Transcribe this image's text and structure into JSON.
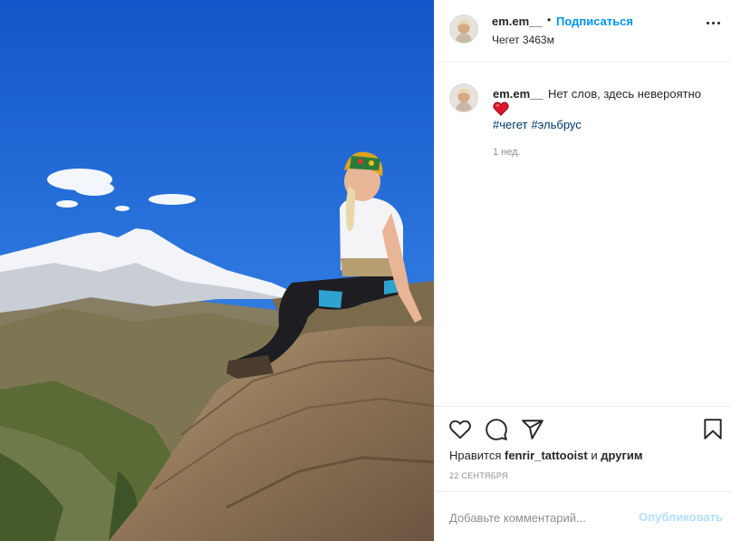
{
  "header": {
    "username": "em.em__",
    "dot": "•",
    "follow_label": "Подписаться",
    "location": "Чегет 3463м"
  },
  "caption": {
    "username": "em.em__",
    "text": "Нет слов, здесь невероятно",
    "emoji": "red-heart",
    "hashtags": [
      "#чегет",
      "#эльбрус"
    ],
    "time": "1 нед."
  },
  "actions": {
    "likes_prefix": "Нравится",
    "likes_user": "fenrir_tattooist",
    "likes_and": "и",
    "likes_others": "другим",
    "date": "22 СЕНТЯБРЯ"
  },
  "comment_box": {
    "placeholder": "Добавьте комментарий...",
    "post_label": "Опубликовать"
  },
  "colors": {
    "accent": "#0095f6",
    "post_disabled": "#b2dffc",
    "hashtag": "#00376b",
    "muted": "#8e8e8e",
    "heart": "#ed4956"
  },
  "icons": [
    "more-options-icon",
    "heart-icon",
    "comment-icon",
    "share-icon",
    "bookmark-icon",
    "red-heart-emoji"
  ]
}
